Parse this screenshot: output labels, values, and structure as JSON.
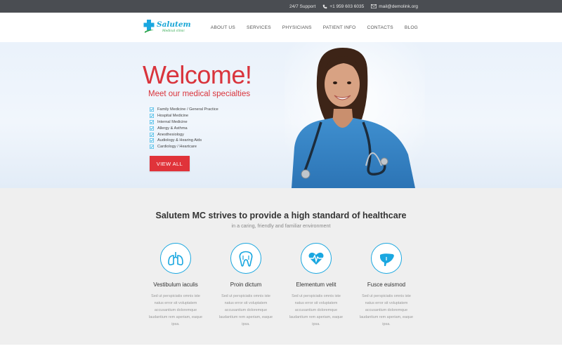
{
  "topbar": {
    "support": "24/7 Support",
    "phone": "+1 959 603 6035",
    "email": "mail@demolink.org"
  },
  "logo": {
    "name": "Salutem",
    "tagline": "Medical clinic"
  },
  "nav": [
    "ABOUT US",
    "SERVICES",
    "PHYSICIANS",
    "PATIENT INFO",
    "CONTACTS",
    "BLOG"
  ],
  "hero": {
    "title": "Welcome!",
    "subtitle": "Meet our medical specialties",
    "specialties": [
      "Family Medicine / General Practice",
      "Hospital Medicine",
      "Internal Medicine",
      "Allergy & Asthma",
      "Anesthesiology",
      "Audiology & Hearing Aids",
      "Cardiology / Heartcare"
    ],
    "button": "VIEW ALL"
  },
  "features": {
    "title": "Salutem MC strives to provide a high standard of healthcare",
    "subtitle": "in a caring, friendly and familiar environment",
    "cards": [
      {
        "icon": "lungs-icon",
        "title": "Vestibulum iaculis",
        "text": "Sed ut perspiciatis omnis iste natus error sit voluptatem accusantium doloremque laudantium rem aperiam, eaque ipsa."
      },
      {
        "icon": "tooth-icon",
        "title": "Proin dictum",
        "text": "Sed ut perspiciatis omnis iste natus error sit voluptatem accusantium doloremque laudantium rem aperiam, eaque ipsa."
      },
      {
        "icon": "heartbeat-icon",
        "title": "Elementum velit",
        "text": "Sed ut perspiciatis omnis iste natus error sit voluptatem accusantium doloremque laudantium rem aperiam, eaque ipsa."
      },
      {
        "icon": "liver-icon",
        "title": "Fusce euismod",
        "text": "Sed ut perspiciatis omnis iste natus error sit voluptatem accusantium doloremque laudantium rem aperiam, eaque ipsa."
      }
    ]
  },
  "colors": {
    "accent_red": "#e0333a",
    "accent_blue": "#1aa7e0",
    "topbar": "#4a4d52"
  }
}
